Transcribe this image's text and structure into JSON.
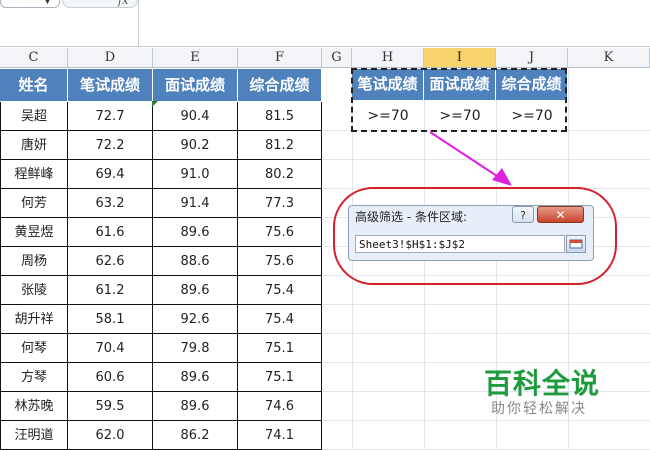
{
  "formula_bar": {
    "fx_label": "fx"
  },
  "columns": [
    {
      "letter": "C",
      "selected": false
    },
    {
      "letter": "D",
      "selected": false
    },
    {
      "letter": "E",
      "selected": false
    },
    {
      "letter": "F",
      "selected": false
    },
    {
      "letter": "G",
      "selected": false
    },
    {
      "letter": "H",
      "selected": false
    },
    {
      "letter": "I",
      "selected": true
    },
    {
      "letter": "J",
      "selected": false
    },
    {
      "letter": "K",
      "selected": false
    }
  ],
  "table": {
    "headers": [
      "姓名",
      "笔试成绩",
      "面试成绩",
      "综合成绩"
    ],
    "rows": [
      [
        "吴超",
        "72.7",
        "90.4",
        "81.5"
      ],
      [
        "唐妍",
        "72.2",
        "90.2",
        "81.2"
      ],
      [
        "程鲜峰",
        "69.4",
        "91.0",
        "80.2"
      ],
      [
        "何芳",
        "63.2",
        "91.4",
        "77.3"
      ],
      [
        "黄昱煜",
        "61.6",
        "89.6",
        "75.6"
      ],
      [
        "周杨",
        "62.6",
        "88.6",
        "75.6"
      ],
      [
        "张陵",
        "61.2",
        "89.6",
        "75.4"
      ],
      [
        "胡升祥",
        "58.1",
        "92.6",
        "75.4"
      ],
      [
        "何琴",
        "70.4",
        "79.8",
        "75.1"
      ],
      [
        "方琴",
        "60.6",
        "89.6",
        "75.1"
      ],
      [
        "林苏晚",
        "59.5",
        "89.6",
        "74.6"
      ],
      [
        "汪明道",
        "62.0",
        "86.2",
        "74.1"
      ]
    ]
  },
  "criteria": {
    "headers": [
      "笔试成绩",
      "面试成绩",
      "综合成绩"
    ],
    "values": [
      ">=70",
      ">=70",
      ">=70"
    ]
  },
  "dialog": {
    "title": "高级筛选 - 条件区域:",
    "help_label": "?",
    "close_label": "✕",
    "input_value": "Sheet3!$H$1:$J$2"
  },
  "watermark": {
    "title": "百科全说",
    "subtitle": "助你轻松解决"
  },
  "colors": {
    "header_blue": "#4f81bd",
    "selected_col": "#f6d36b",
    "ellipse_red": "#d4202a",
    "arrow_magenta": "#e020e0",
    "watermark_green": "#1f9b3e"
  }
}
